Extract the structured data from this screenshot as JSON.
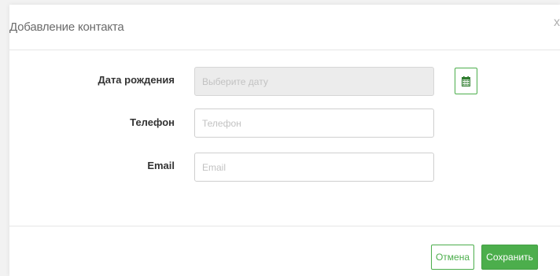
{
  "dialog": {
    "title": "Добавление контакта",
    "close_glyph": "x"
  },
  "form": {
    "birthdate": {
      "label": "Дата рождения",
      "placeholder": "Выберите дату",
      "value": ""
    },
    "phone": {
      "label": "Телефон",
      "placeholder": "Телефон",
      "value": ""
    },
    "email": {
      "label": "Email",
      "placeholder": "Email",
      "value": ""
    },
    "calendar_icon": "calendar-icon"
  },
  "footer": {
    "cancel_label": "Отмена",
    "save_label": "Сохранить"
  },
  "colors": {
    "accent": "#4cae4c",
    "disabled_field": "#ececec"
  }
}
